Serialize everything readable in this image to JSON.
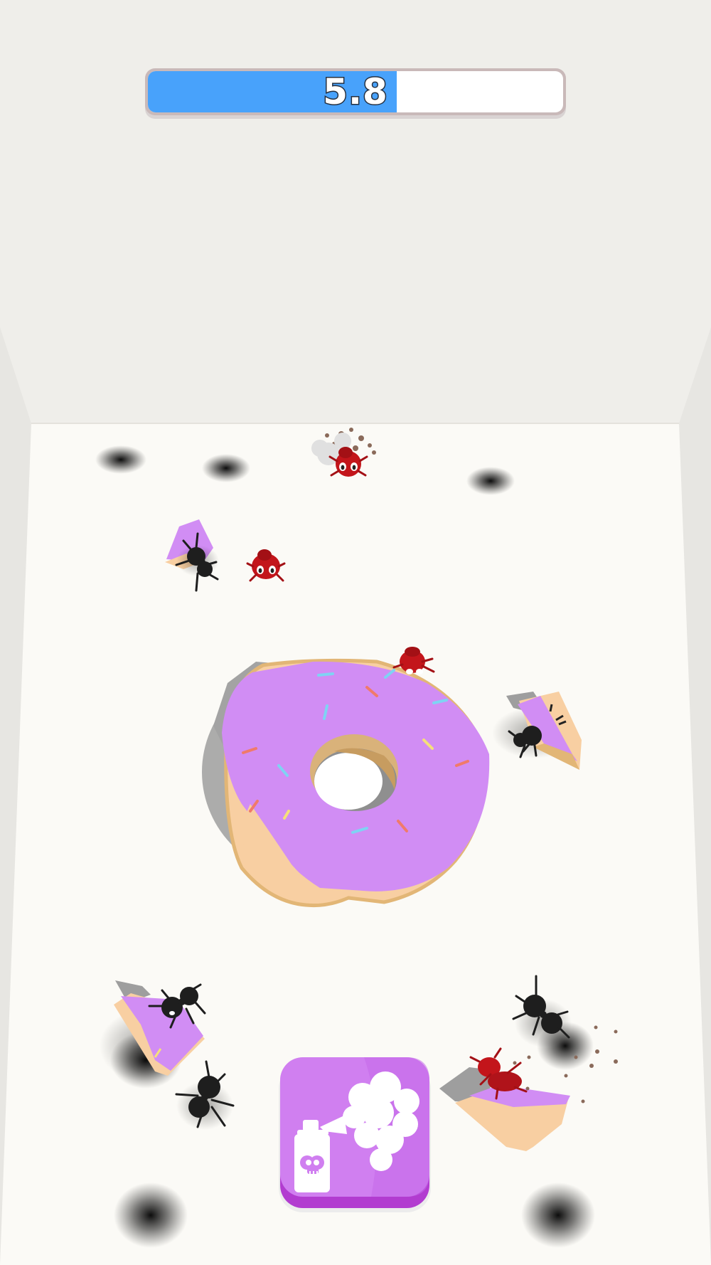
{
  "hud": {
    "timer_value": "5.8",
    "timer_progress": 0.6,
    "timer_fill_color": "#48a2fb"
  },
  "action": {
    "spray_button_icon": "bug-spray-icon",
    "spray_button_color": "#d07ff0"
  },
  "colors": {
    "floor": "#fbfaf6",
    "wall": "#efeeea",
    "frosting": "#d18df4",
    "dough": "#f8cfa2",
    "ant_black": "#1e1e1e",
    "ant_red": "#c3151b"
  }
}
